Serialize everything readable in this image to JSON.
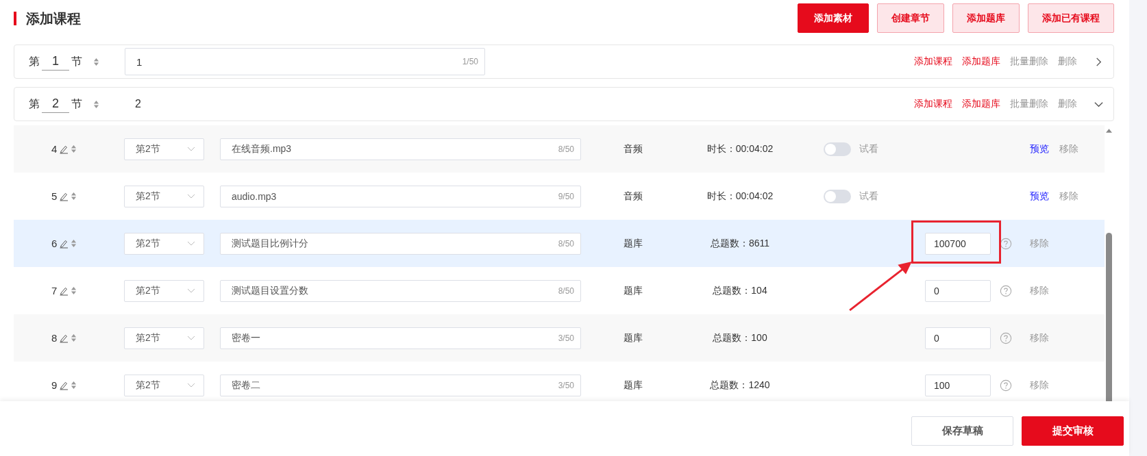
{
  "page": {
    "title": "添加课程"
  },
  "toolbar": [
    {
      "label": "添加素材",
      "kind": "primary"
    },
    {
      "label": "创建章节",
      "kind": "secondary"
    },
    {
      "label": "添加题库",
      "kind": "secondary"
    },
    {
      "label": "添加已有课程",
      "kind": "secondary"
    }
  ],
  "sections": [
    {
      "prefix": "第",
      "number": "1",
      "suffix": "节",
      "title": "1",
      "editing": true,
      "counter": "1/50",
      "expanded": false,
      "actions": [
        {
          "label": "添加课程",
          "kind": "primary"
        },
        {
          "label": "添加题库",
          "kind": "primary"
        },
        {
          "label": "批量删除",
          "kind": "muted"
        },
        {
          "label": "删除",
          "kind": "muted"
        }
      ]
    },
    {
      "prefix": "第",
      "number": "2",
      "suffix": "节",
      "title": "2",
      "editing": false,
      "expanded": true,
      "actions": [
        {
          "label": "添加课程",
          "kind": "primary"
        },
        {
          "label": "添加题库",
          "kind": "primary"
        },
        {
          "label": "批量删除",
          "kind": "muted"
        },
        {
          "label": "删除",
          "kind": "muted"
        }
      ]
    }
  ],
  "items": [
    {
      "index": "4",
      "selected": false,
      "chapter": "第2节",
      "name": "在线音频.mp3",
      "counter": "8/50",
      "type": "音频",
      "info": "时长：00:04:02",
      "kind": "media",
      "trial": {
        "on": false,
        "label": "试看"
      },
      "actions": [
        {
          "label": "预览",
          "kind": "preview"
        },
        {
          "label": "移除",
          "kind": "remove"
        }
      ]
    },
    {
      "index": "5",
      "selected": false,
      "chapter": "第2节",
      "name": "audio.mp3",
      "counter": "9/50",
      "type": "音频",
      "info": "时长：00:04:02",
      "kind": "media",
      "trial": {
        "on": false,
        "label": "试看"
      },
      "actions": [
        {
          "label": "预览",
          "kind": "preview"
        },
        {
          "label": "移除",
          "kind": "remove"
        }
      ]
    },
    {
      "index": "6",
      "selected": true,
      "chapter": "第2节",
      "name": "测试题目比例计分",
      "counter": "8/50",
      "type": "题库",
      "info": "总题数：8611",
      "kind": "quiz",
      "score": "100700",
      "annotated": true,
      "actions": [
        {
          "label": "移除",
          "kind": "remove"
        }
      ]
    },
    {
      "index": "7",
      "selected": false,
      "chapter": "第2节",
      "name": "测试题目设置分数",
      "counter": "8/50",
      "type": "题库",
      "info": "总题数：104",
      "kind": "quiz",
      "score": "0",
      "annotated": false,
      "actions": [
        {
          "label": "移除",
          "kind": "remove"
        }
      ]
    },
    {
      "index": "8",
      "selected": false,
      "chapter": "第2节",
      "name": "密卷一",
      "counter": "3/50",
      "type": "题库",
      "info": "总题数：100",
      "kind": "quiz",
      "score": "0",
      "annotated": false,
      "actions": [
        {
          "label": "移除",
          "kind": "remove"
        }
      ]
    },
    {
      "index": "9",
      "selected": false,
      "chapter": "第2节",
      "name": "密卷二",
      "counter": "3/50",
      "type": "题库",
      "info": "总题数：1240",
      "kind": "quiz",
      "score": "100",
      "annotated": false,
      "actions": [
        {
          "label": "移除",
          "kind": "remove"
        }
      ]
    }
  ],
  "footer": [
    {
      "label": "保存草稿",
      "kind": "secondary"
    },
    {
      "label": "提交审核",
      "kind": "primary"
    }
  ]
}
